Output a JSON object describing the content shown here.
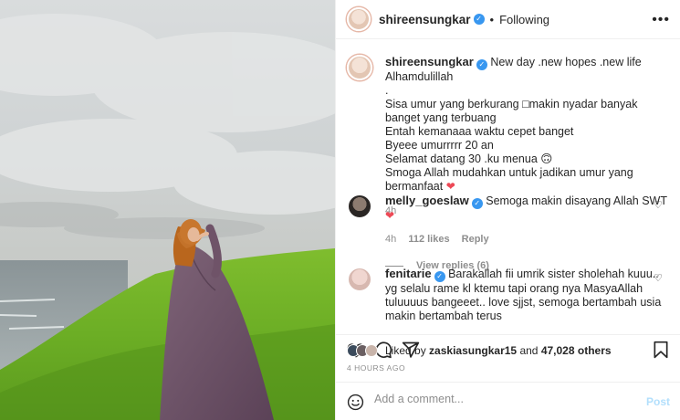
{
  "post": {
    "username": "shireensungkar",
    "follow_status": "Following",
    "separator": "•",
    "more_label": "•••"
  },
  "caption": {
    "username": "shireensungkar",
    "lines": [
      "New day .new hopes .new life Alhamdulillah",
      ".",
      "Sisa umur yang berkurang □makin nyadar banyak banget yang terbuang",
      "Entah kemanaaa waktu cepet banget",
      "Byeee umurrrrr 20 an",
      "Selamat datang 30 .ku menua 🙃",
      "Smoga Allah mudahkan untuk jadikan umur yang bermanfaat"
    ],
    "time": "4h"
  },
  "comments": [
    {
      "username": "melly_goeslaw",
      "text": "Semoga makin disayang Allah SWT",
      "time": "4h",
      "likes": "112 likes",
      "reply": "Reply",
      "view_replies": "View replies (6)"
    },
    {
      "username": "fenitarie",
      "text": "Barakallah fii umrik sister sholehah kuuu.. yg selalu rame kl ktemu tapi orang nya MasyaAllah tuluuuus bangeeet.. love sjjst, semoga bertambah usia makin bertambah terus"
    }
  ],
  "likes": {
    "prefix": "Liked by",
    "user": "zaskiasungkar15",
    "middle": "and",
    "count": "47,028 others"
  },
  "timestamp": "4 HOURS AGO",
  "add_comment": {
    "placeholder": "Add a comment...",
    "post_label": "Post"
  },
  "colors": {
    "verified": "#3897f0",
    "heart_red": "#ed4956",
    "post_disabled": "#b2dffc",
    "muted": "#8e8e8e"
  },
  "icons": [
    "heart-icon",
    "comment-icon",
    "share-icon",
    "bookmark-icon",
    "emoji-icon",
    "verified-icon",
    "more-icon"
  ]
}
